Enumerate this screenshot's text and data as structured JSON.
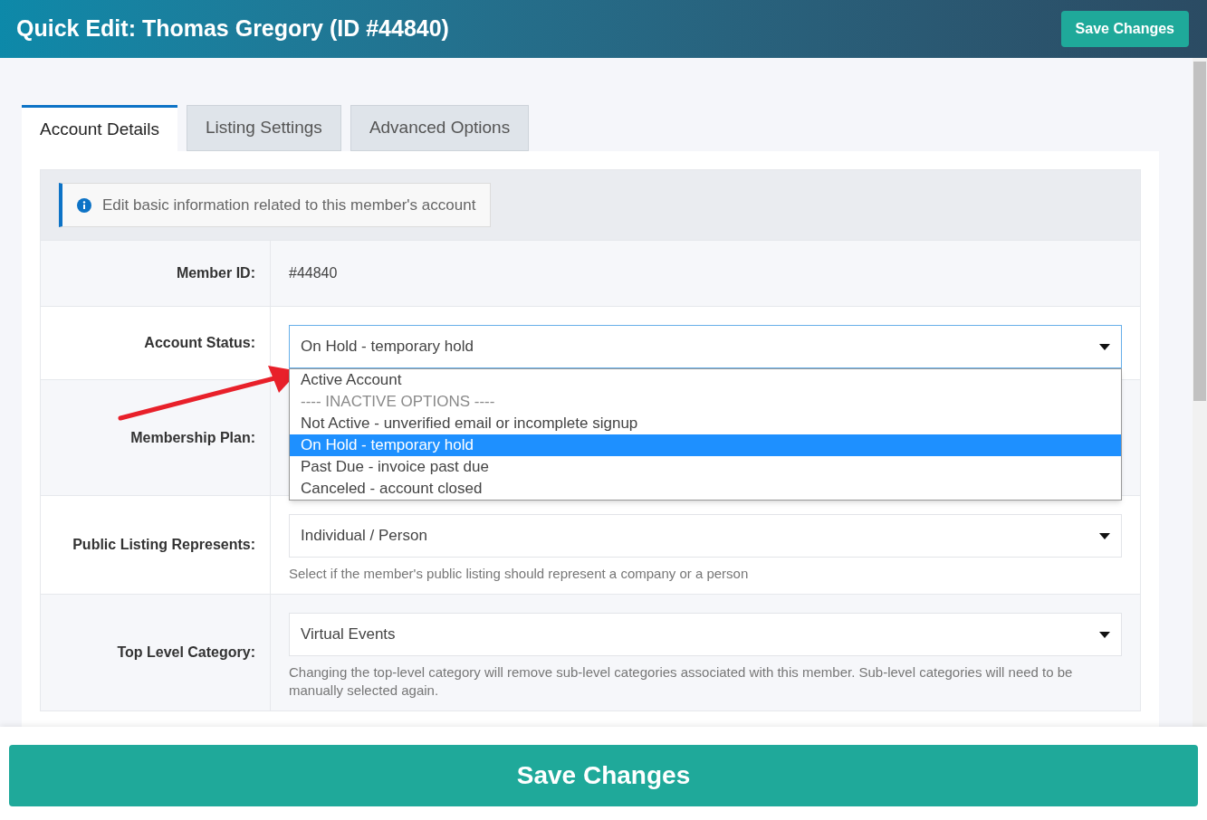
{
  "header": {
    "title": "Quick Edit: Thomas Gregory (ID #44840)",
    "save_button": "Save Changes"
  },
  "tabs": [
    {
      "label": "Account Details",
      "selected": true
    },
    {
      "label": "Listing Settings",
      "selected": false
    },
    {
      "label": "Advanced Options",
      "selected": false
    }
  ],
  "info": "Edit basic information related to this member's account",
  "fields": [
    {
      "kind": "text",
      "label": "Member ID:",
      "value": "#44840"
    },
    {
      "kind": "select",
      "label": "Account Status:",
      "value": "On Hold - temporary hold",
      "expanded": true,
      "options": [
        {
          "label": "Active Account",
          "selected": false,
          "disabled": false
        },
        {
          "label": "---- INACTIVE OPTIONS ----",
          "selected": false,
          "disabled": true
        },
        {
          "label": "Not Active - unverified email or incomplete signup",
          "selected": false,
          "disabled": false
        },
        {
          "label": "On Hold - temporary hold",
          "selected": true,
          "disabled": false
        },
        {
          "label": "Past Due - invoice past due",
          "selected": false,
          "disabled": false
        },
        {
          "label": "Canceled - account closed",
          "selected": false,
          "disabled": false
        }
      ]
    },
    {
      "kind": "covered",
      "label": "Membership Plan:"
    },
    {
      "kind": "select",
      "label": "Public Listing Represents:",
      "value": "Individual / Person",
      "expanded": false,
      "help": "Select if the member's public listing should represent a company or a person"
    },
    {
      "kind": "select",
      "label": "Top Level Category:",
      "value": "Virtual Events",
      "expanded": false,
      "help": "Changing the top-level category will remove sub-level categories associated with this member. Sub-level categories will need to be manually selected again."
    }
  ],
  "footer_button": "Save Changes"
}
